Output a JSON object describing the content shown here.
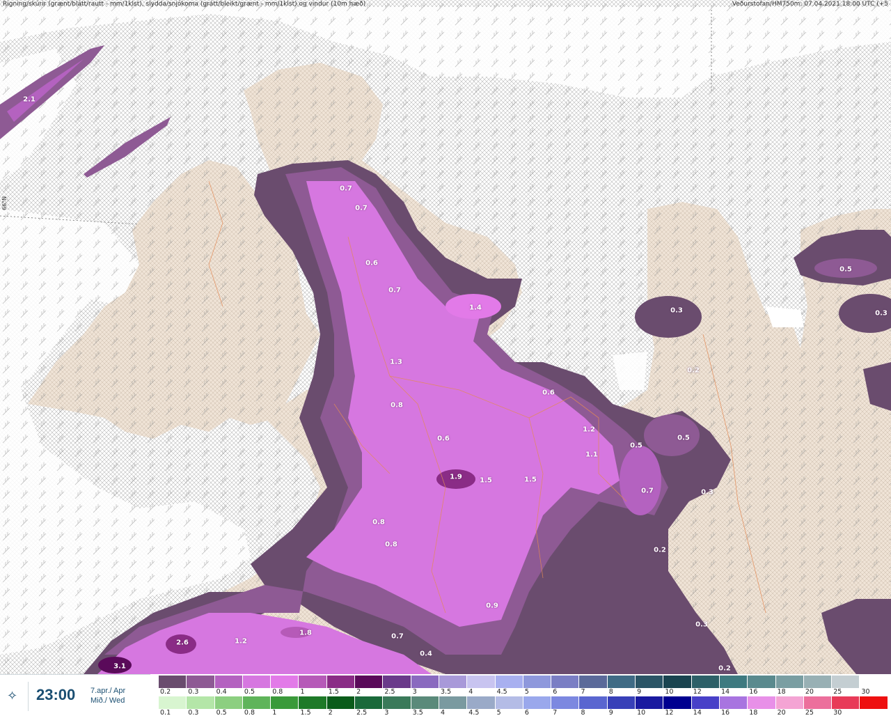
{
  "header": {
    "left": "Rigning/skúrir (grænt/blátt/rautt - mm/1klst), slydda/snjókoma (grátt/bleikt/grænt - mm/1klst) og vindur (10m hæð)",
    "right": "Veðurstofan/HM750m: 07.04.2021 18:00 UTC (+5"
  },
  "map": {
    "lat_label": "66°N",
    "values": [
      "2.1",
      "0.7",
      "0.7",
      "0.6",
      "0.7",
      "1.4",
      "1.3",
      "0.8",
      "0.6",
      "0.6",
      "1.2",
      "1.1",
      "0.5",
      "0.5",
      "0.7",
      "0.3",
      "0.2",
      "0.3",
      "1.9",
      "1.5",
      "1.5",
      "0.8",
      "0.8",
      "0.9",
      "2.6",
      "1.2",
      "1.8",
      "0.7",
      "0.4",
      "3.1",
      "0.3",
      "0.5",
      "0.3",
      "0.2",
      "0.2"
    ]
  },
  "timebox": {
    "time": "23:00",
    "date_line1": "7.apr./ Apr",
    "date_line2": "Mið./ Wed"
  },
  "legend": {
    "row1_colors": [
      "#6a4c6e",
      "#8e5a94",
      "#b462c0",
      "#d677e0",
      "#e27ae8",
      "#b65ab8",
      "#8a2c86",
      "#5a0a5a",
      "#6a3a8a",
      "#8a6abf",
      "#a899d9",
      "#c8c4f0",
      "#a8b0f0",
      "#8e98dc",
      "#7a7ec4",
      "#5b6a9a",
      "#3f6b85",
      "#2b5566",
      "#1a4450",
      "#2d6068",
      "#3e7a80",
      "#5a8a8e",
      "#7a9ea2",
      "#98b0b4",
      "#c4ced2",
      "#ffffff"
    ],
    "row1_labels": [
      "0.2",
      "0.3",
      "0.4",
      "0.5",
      "0.8",
      "1",
      "1.5",
      "2",
      "2.5",
      "3",
      "3.5",
      "4",
      "4.5",
      "5",
      "6",
      "7",
      "8",
      "9",
      "10",
      "12",
      "14",
      "16",
      "18",
      "20",
      "25",
      "30"
    ],
    "row2_colors": [
      "#d8f5d0",
      "#b4e6a8",
      "#8ccf80",
      "#5fb45a",
      "#3a9a3a",
      "#1e7a28",
      "#0a5c1a",
      "#1a6a3a",
      "#3a7a5a",
      "#5a8a7a",
      "#7a9aa0",
      "#9aaac8",
      "#b4bce6",
      "#9aa8ec",
      "#7c88e0",
      "#5a66d0",
      "#3840b8",
      "#1a1aa0",
      "#000090",
      "#4840c8",
      "#a874e0",
      "#e890e8",
      "#f4a4d4",
      "#ec6f9c",
      "#e83a58",
      "#ee1010"
    ],
    "row2_labels": [
      "0.1",
      "0.3",
      "0.5",
      "0.8",
      "1",
      "1.5",
      "2",
      "2.5",
      "3",
      "3.5",
      "4",
      "4.5",
      "5",
      "6",
      "7",
      "8",
      "9",
      "10",
      "12",
      "14",
      "16",
      "18",
      "20",
      "25",
      "30"
    ]
  }
}
